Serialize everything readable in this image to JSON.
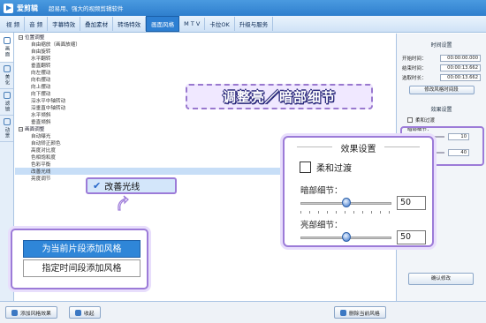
{
  "app": {
    "name": "爱剪辑",
    "slogan": "超易用、强大的视频剪辑软件"
  },
  "menu_tabs": [
    "视 频",
    "音 频",
    "字幕特效",
    "叠加素材",
    "转场特效",
    "画面风格",
    "M T V",
    "卡拉OK",
    "升级与服务"
  ],
  "active_tab_index": 5,
  "left_tabs": [
    "画面",
    "美化",
    "滤镜",
    "动景"
  ],
  "tree": {
    "group1": "位置调整",
    "group1_items": [
      "自由缩放（画面放缩）",
      "自由旋转",
      "水平翻转",
      "垂直翻转",
      "向左摆动",
      "向右摆动",
      "向上摆动",
      "向下摆动",
      "沿水平中轴转动",
      "沿垂直中轴转动",
      "水平倾斜",
      "垂直倾斜"
    ],
    "group2": "画面调整",
    "group2_items": [
      "自动曝光",
      "自动矫正颜色",
      "高度对比度",
      "色相饱和度",
      "色彩平衡",
      "改善光线",
      "亮度调节"
    ]
  },
  "callout_title": "调整亮／暗部细节",
  "right_panel": {
    "time_header": "时间设置",
    "start_label": "开始时间：",
    "start_value": "00:00:00.000",
    "end_label": "结束时间：",
    "end_value": "00:00:13.662",
    "dur_label": "选取时长：",
    "dur_value": "00:00:13.662",
    "modify_btn": "修改风格时间段",
    "effect_header": "效果设置",
    "soft_label": "柔和过渡",
    "dark_label": "暗部细节：",
    "dark_value": "10",
    "bright_value": "40",
    "confirm_btn": "确认修改"
  },
  "effect_dialog": {
    "title": "效果设置",
    "soft_label": "柔和过渡",
    "dark_label": "暗部细节：",
    "dark_value": "50",
    "dark_level": 0.5,
    "bright_label": "亮部细节：",
    "bright_value": "50",
    "bright_level": 0.5
  },
  "improve_item": "改善光线",
  "context_menu": [
    "为当前片段添加风格",
    "指定时间段添加风格"
  ],
  "bottom": {
    "add_btn": "添加风格效果",
    "collapse_btn": "收起",
    "delete_btn": "删除当前风格"
  }
}
